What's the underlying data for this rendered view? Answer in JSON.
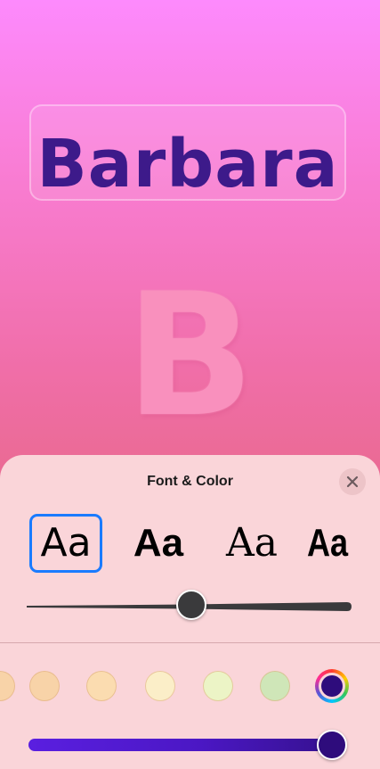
{
  "preview": {
    "name": "Barbara",
    "monogram": "B"
  },
  "sheet": {
    "title": "Font & Color",
    "close_icon": "close-icon"
  },
  "fonts": [
    {
      "sample": "Aa",
      "selected": true
    },
    {
      "sample": "Aa",
      "selected": false
    },
    {
      "sample": "Aa",
      "selected": false
    },
    {
      "sample": "Aa",
      "selected": false
    }
  ],
  "weight_slider": {
    "value": 0.5
  },
  "swatches": [
    {
      "color": "#f8d3a8"
    },
    {
      "color": "#fbdcb0"
    },
    {
      "color": "#fbeec8"
    },
    {
      "color": "#ecf4c6"
    },
    {
      "color": "#cfe6b8"
    },
    {
      "color": "#2e0c7c",
      "selected": true
    }
  ],
  "hue_slider": {
    "value": 1.0,
    "color": "#2e0c7c"
  }
}
